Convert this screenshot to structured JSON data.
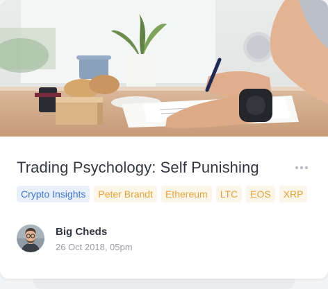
{
  "post": {
    "title": "Trading Psychology: Self Punishing",
    "more_icon": "more-horizontal-icon",
    "tags": [
      {
        "label": "Crypto Insights",
        "kind": "primary"
      },
      {
        "label": "Peter Brandt",
        "kind": "secondary"
      },
      {
        "label": "Ethereum",
        "kind": "secondary"
      },
      {
        "label": "LTC",
        "kind": "secondary"
      },
      {
        "label": "EOS",
        "kind": "secondary"
      },
      {
        "label": "XRP",
        "kind": "secondary"
      }
    ],
    "author": {
      "name": "Big Cheds",
      "date": "26 Oct 2018, 05pm"
    }
  },
  "colors": {
    "primary_tag_bg": "#e8f0fc",
    "primary_tag_text": "#3f72d8",
    "secondary_tag_bg": "#fdf5e7",
    "secondary_tag_text": "#e2a43a",
    "title_text": "#333640",
    "muted_text": "#9a9da6"
  }
}
